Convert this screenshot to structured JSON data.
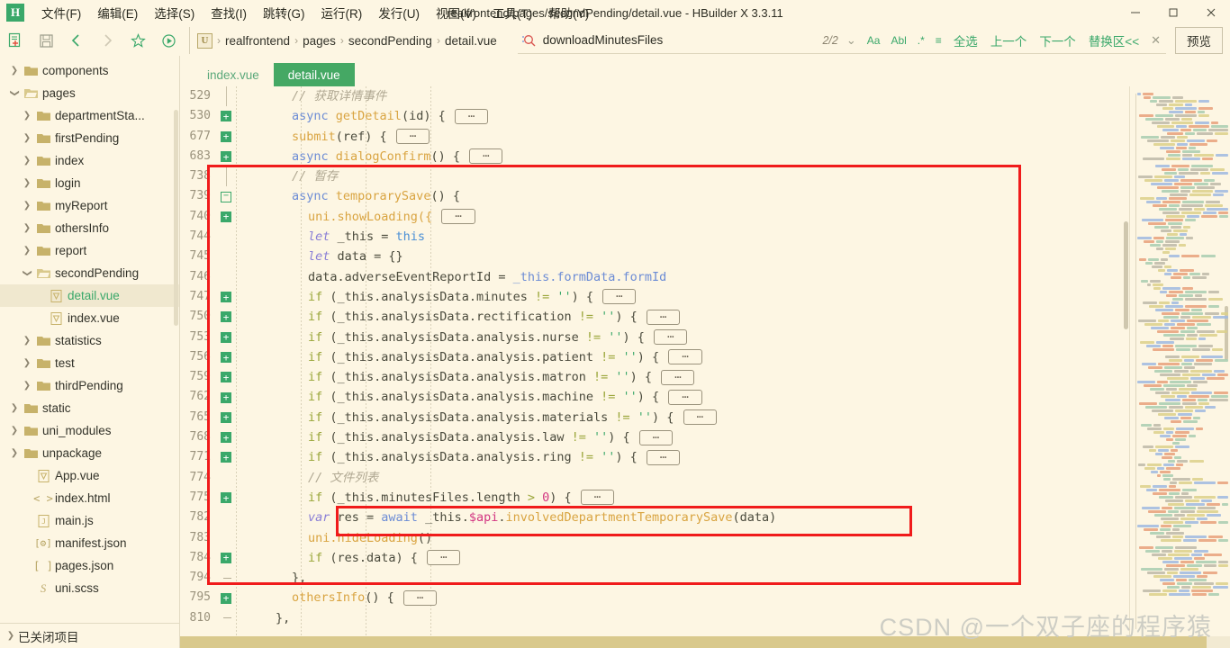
{
  "window": {
    "title": "realfrontend/pages/secondPending/detail.vue - HBuilder X 3.3.11",
    "minimize_label": "—",
    "maximize_label": "❐",
    "close_label": "✕"
  },
  "menubar": {
    "logo": "H",
    "items": [
      {
        "label": "文件(F)",
        "name": "menu-file"
      },
      {
        "label": "编辑(E)",
        "name": "menu-edit"
      },
      {
        "label": "选择(S)",
        "name": "menu-select"
      },
      {
        "label": "查找(I)",
        "name": "menu-find"
      },
      {
        "label": "跳转(G)",
        "name": "menu-goto"
      },
      {
        "label": "运行(R)",
        "name": "menu-run"
      },
      {
        "label": "发行(U)",
        "name": "menu-publish"
      },
      {
        "label": "视图(V)",
        "name": "menu-view"
      },
      {
        "label": "工具(T)",
        "name": "menu-tools"
      },
      {
        "label": "帮助(Y)",
        "name": "menu-help"
      }
    ]
  },
  "toolbar": {
    "icons": [
      {
        "name": "new-file-icon",
        "glyph": "new"
      },
      {
        "name": "save-icon",
        "glyph": "save"
      },
      {
        "name": "back-icon",
        "glyph": "back"
      },
      {
        "name": "forward-icon",
        "glyph": "forward"
      },
      {
        "name": "favorite-star-icon",
        "glyph": "star"
      },
      {
        "name": "run-icon",
        "glyph": "run"
      }
    ],
    "breadcrumb": {
      "project_badge": "U",
      "parts": [
        "realfrontend",
        "pages",
        "secondPending",
        "detail.vue"
      ],
      "separator": "›"
    },
    "preview_label": "预览"
  },
  "search": {
    "value": "downloadMinutesFiles",
    "placeholder": "查找",
    "match_count": "2/2",
    "dropdown_glyph": "⌄",
    "options": [
      {
        "name": "match-case-option",
        "label": "Aa"
      },
      {
        "name": "whole-word-option",
        "label": "Abl"
      },
      {
        "name": "regex-option",
        "label": ".*"
      },
      {
        "name": "in-selection-option",
        "label": "≡"
      }
    ],
    "links": [
      {
        "name": "select-all-link",
        "label": "全选"
      },
      {
        "name": "previous-match-link",
        "label": "上一个"
      },
      {
        "name": "next-match-link",
        "label": "下一个"
      },
      {
        "name": "replace-panel-link",
        "label": "替换区<<"
      }
    ],
    "close_label": "✕"
  },
  "sidebar": {
    "closed_projects_label": "已关闭项目",
    "tree": [
      {
        "label": "components",
        "type": "folder",
        "depth": 1,
        "expanded": false
      },
      {
        "label": "pages",
        "type": "folder",
        "depth": 1,
        "expanded": true
      },
      {
        "label": "departmentSta...",
        "type": "folder",
        "depth": 2,
        "expanded": false
      },
      {
        "label": "firstPending",
        "type": "folder",
        "depth": 2,
        "expanded": false
      },
      {
        "label": "index",
        "type": "folder",
        "depth": 2,
        "expanded": false
      },
      {
        "label": "login",
        "type": "folder",
        "depth": 2,
        "expanded": false
      },
      {
        "label": "myReport",
        "type": "folder",
        "depth": 2,
        "expanded": false
      },
      {
        "label": "othersInfo",
        "type": "folder",
        "depth": 2,
        "expanded": false
      },
      {
        "label": "report",
        "type": "folder",
        "depth": 2,
        "expanded": false
      },
      {
        "label": "secondPending",
        "type": "folder",
        "depth": 2,
        "expanded": true
      },
      {
        "label": "detail.vue",
        "type": "vue",
        "depth": 3,
        "selected": true
      },
      {
        "label": "index.vue",
        "type": "vue",
        "depth": 3
      },
      {
        "label": "statistics",
        "type": "folder",
        "depth": 2,
        "expanded": false
      },
      {
        "label": "test",
        "type": "folder",
        "depth": 2,
        "expanded": false
      },
      {
        "label": "thirdPending",
        "type": "folder",
        "depth": 2,
        "expanded": false
      },
      {
        "label": "static",
        "type": "folder",
        "depth": 1,
        "expanded": false
      },
      {
        "label": "uni_modules",
        "type": "folder",
        "depth": 1,
        "expanded": false
      },
      {
        "label": "unpackage",
        "type": "folder",
        "depth": 1,
        "expanded": false
      },
      {
        "label": "App.vue",
        "type": "vue",
        "depth": 2
      },
      {
        "label": "index.html",
        "type": "html",
        "depth": 2
      },
      {
        "label": "main.js",
        "type": "js",
        "depth": 2
      },
      {
        "label": "manifest.json",
        "type": "manifest",
        "depth": 2
      },
      {
        "label": "pages.json",
        "type": "json",
        "depth": 2
      },
      {
        "label": "uni.scss",
        "type": "scss",
        "depth": 2
      }
    ]
  },
  "tabs": [
    {
      "label": "index.vue",
      "active": false,
      "name": "tab-index-vue"
    },
    {
      "label": "detail.vue",
      "active": true,
      "name": "tab-detail-vue"
    }
  ],
  "editor": {
    "ellipsis": "⋯",
    "lines": [
      {
        "num": "529",
        "fold": "bar",
        "indent": 3,
        "tokens": [
          {
            "t": "// 获取详情事件",
            "c": "k-cmt"
          }
        ]
      },
      {
        "num": "530",
        "fold": "plus",
        "indent": 3,
        "tokens": [
          {
            "t": "async ",
            "c": "k-blue"
          },
          {
            "t": "getDetail",
            "c": "k-fn"
          },
          {
            "t": "(id) { ",
            "c": "k-pl"
          },
          {
            "t": "BOX",
            "c": "box"
          }
        ]
      },
      {
        "num": "677",
        "fold": "plus",
        "indent": 3,
        "tokens": [
          {
            "t": "submit",
            "c": "k-fn"
          },
          {
            "t": "(ref) { ",
            "c": "k-pl"
          },
          {
            "t": "BOX",
            "c": "box"
          }
        ]
      },
      {
        "num": "683",
        "fold": "plus",
        "indent": 3,
        "tokens": [
          {
            "t": "async ",
            "c": "k-blue"
          },
          {
            "t": "dialogConfirm",
            "c": "k-fn"
          },
          {
            "t": "() { ",
            "c": "k-pl"
          },
          {
            "t": "BOX",
            "c": "box"
          }
        ]
      },
      {
        "num": "738",
        "fold": "bar",
        "indent": 3,
        "tokens": [
          {
            "t": "// 暂存",
            "c": "k-cmt"
          }
        ]
      },
      {
        "num": "739",
        "fold": "minus",
        "indent": 3,
        "tokens": [
          {
            "t": "async ",
            "c": "k-blue"
          },
          {
            "t": "temporarySave",
            "c": "k-fn"
          },
          {
            "t": "() {",
            "c": "k-pl"
          }
        ]
      },
      {
        "num": "740",
        "fold": "plus",
        "indent": 4,
        "tokens": [
          {
            "t": "uni.showLoading({ ",
            "c": "k-fn"
          },
          {
            "t": "BOX",
            "c": "box"
          }
        ]
      },
      {
        "num": "744",
        "fold": "",
        "indent": 4,
        "tokens": [
          {
            "t": "let ",
            "c": "k-kw"
          },
          {
            "t": "_this = ",
            "c": "k-pl"
          },
          {
            "t": "this",
            "c": "k-kw2"
          }
        ]
      },
      {
        "num": "745",
        "fold": "",
        "indent": 4,
        "tokens": [
          {
            "t": "let ",
            "c": "k-kw"
          },
          {
            "t": "data = {}",
            "c": "k-pl"
          }
        ]
      },
      {
        "num": "746",
        "fold": "",
        "indent": 4,
        "tokens": [
          {
            "t": "data.adverseEventReportId = ",
            "c": "k-pl"
          },
          {
            "t": "_this.formData.formId",
            "c": "k-blue"
          }
        ]
      },
      {
        "num": "747",
        "fold": "plus",
        "indent": 4,
        "tokens": [
          {
            "t": "if ",
            "c": "k-ctl"
          },
          {
            "t": "(_this.analysisData.minutes ",
            "c": "k-pl"
          },
          {
            "t": "!=",
            "c": "k-ctl"
          },
          {
            "t": " ",
            "c": "k-pl"
          },
          {
            "t": "''",
            "c": "k-str"
          },
          {
            "t": ") { ",
            "c": "k-pl"
          },
          {
            "t": "BOX",
            "c": "box"
          }
        ]
      },
      {
        "num": "750",
        "fold": "plus",
        "indent": 4,
        "tokens": [
          {
            "t": "if ",
            "c": "k-ctl"
          },
          {
            "t": "(_this.analysisData.rectification ",
            "c": "k-pl"
          },
          {
            "t": "!=",
            "c": "k-ctl"
          },
          {
            "t": " ",
            "c": "k-pl"
          },
          {
            "t": "''",
            "c": "k-str"
          },
          {
            "t": ") { ",
            "c": "k-pl"
          },
          {
            "t": "BOX",
            "c": "box"
          }
        ]
      },
      {
        "num": "753",
        "fold": "plus",
        "indent": 4,
        "tokens": [
          {
            "t": "if ",
            "c": "k-ctl"
          },
          {
            "t": "(_this.analysisData.analysis.nurse ",
            "c": "k-pl"
          },
          {
            "t": "!=",
            "c": "k-ctl"
          },
          {
            "t": " ",
            "c": "k-pl"
          },
          {
            "t": "''",
            "c": "k-str"
          },
          {
            "t": ") { ",
            "c": "k-pl"
          },
          {
            "t": "BOX",
            "c": "box"
          }
        ]
      },
      {
        "num": "756",
        "fold": "plus",
        "indent": 4,
        "tokens": [
          {
            "t": "if ",
            "c": "k-ctl"
          },
          {
            "t": "(_this.analysisData.analysis.patient ",
            "c": "k-pl"
          },
          {
            "t": "!=",
            "c": "k-ctl"
          },
          {
            "t": " ",
            "c": "k-pl"
          },
          {
            "t": "''",
            "c": "k-str"
          },
          {
            "t": ") { ",
            "c": "k-pl"
          },
          {
            "t": "BOX",
            "c": "box"
          }
        ]
      },
      {
        "num": "759",
        "fold": "plus",
        "indent": 4,
        "tokens": [
          {
            "t": "if ",
            "c": "k-ctl"
          },
          {
            "t": "(_this.analysisData.analysis.matron ",
            "c": "k-pl"
          },
          {
            "t": "!=",
            "c": "k-ctl"
          },
          {
            "t": " ",
            "c": "k-pl"
          },
          {
            "t": "''",
            "c": "k-str"
          },
          {
            "t": ") { ",
            "c": "k-pl"
          },
          {
            "t": "BOX",
            "c": "box"
          }
        ]
      },
      {
        "num": "762",
        "fold": "plus",
        "indent": 4,
        "tokens": [
          {
            "t": "if ",
            "c": "k-ctl"
          },
          {
            "t": "(_this.analysisData.analysis.machine ",
            "c": "k-pl"
          },
          {
            "t": "!=",
            "c": "k-ctl"
          },
          {
            "t": " ",
            "c": "k-pl"
          },
          {
            "t": "''",
            "c": "k-str"
          },
          {
            "t": ") { ",
            "c": "k-pl"
          },
          {
            "t": "BOX",
            "c": "box"
          }
        ]
      },
      {
        "num": "765",
        "fold": "plus",
        "indent": 4,
        "tokens": [
          {
            "t": "if ",
            "c": "k-ctl"
          },
          {
            "t": "(_this.analysisData.analysis.materials ",
            "c": "k-pl"
          },
          {
            "t": "!=",
            "c": "k-ctl"
          },
          {
            "t": " ",
            "c": "k-pl"
          },
          {
            "t": "''",
            "c": "k-str"
          },
          {
            "t": ") { ",
            "c": "k-pl"
          },
          {
            "t": "BOX",
            "c": "box"
          }
        ]
      },
      {
        "num": "768",
        "fold": "plus",
        "indent": 4,
        "tokens": [
          {
            "t": "if ",
            "c": "k-ctl"
          },
          {
            "t": "(_this.analysisData.analysis.law ",
            "c": "k-pl"
          },
          {
            "t": "!=",
            "c": "k-ctl"
          },
          {
            "t": " ",
            "c": "k-pl"
          },
          {
            "t": "''",
            "c": "k-str"
          },
          {
            "t": ") { ",
            "c": "k-pl"
          },
          {
            "t": "BOX",
            "c": "box"
          }
        ]
      },
      {
        "num": "771",
        "fold": "plus",
        "indent": 4,
        "tokens": [
          {
            "t": "if ",
            "c": "k-ctl"
          },
          {
            "t": "(_this.analysisData.analysis.ring ",
            "c": "k-pl"
          },
          {
            "t": "!=",
            "c": "k-ctl"
          },
          {
            "t": " ",
            "c": "k-pl"
          },
          {
            "t": "''",
            "c": "k-str"
          },
          {
            "t": ") { ",
            "c": "k-pl"
          },
          {
            "t": "BOX",
            "c": "box"
          }
        ]
      },
      {
        "num": "774",
        "fold": "",
        "indent": 4,
        "tokens": [
          {
            "t": "// 文件列表",
            "c": "k-cmt"
          }
        ]
      },
      {
        "num": "775",
        "fold": "plus",
        "indent": 4,
        "tokens": [
          {
            "t": "if ",
            "c": "k-ctl"
          },
          {
            "t": "(_this.minutesFiles.length ",
            "c": "k-pl"
          },
          {
            "t": ">",
            "c": "k-ctl"
          },
          {
            "t": " ",
            "c": "k-pl"
          },
          {
            "t": "0",
            "c": "k-num"
          },
          {
            "t": ") { ",
            "c": "k-pl"
          },
          {
            "t": "BOX",
            "c": "box"
          }
        ]
      },
      {
        "num": "782",
        "fold": "",
        "indent": 4,
        "highlight": true,
        "tokens": [
          {
            "t": "var ",
            "c": "k-kw"
          },
          {
            "t": "res = ",
            "c": "k-pl"
          },
          {
            "t": "await",
            "c": "k-blue"
          },
          {
            "t": " _this.",
            "c": "k-pl"
          },
          {
            "t": "$api",
            "c": "k-num"
          },
          {
            "t": ".",
            "c": "k-pl"
          },
          {
            "t": "involvedDepartmentTemporarySave",
            "c": "k-fn"
          },
          {
            "t": "(data)",
            "c": "k-pl"
          }
        ]
      },
      {
        "num": "783",
        "fold": "",
        "indent": 4,
        "tokens": [
          {
            "t": "uni.hideLoading",
            "c": "k-fn"
          },
          {
            "t": "()",
            "c": "k-pl"
          }
        ]
      },
      {
        "num": "784",
        "fold": "plus",
        "indent": 4,
        "tokens": [
          {
            "t": "if ",
            "c": "k-ctl"
          },
          {
            "t": "(res.data) { ",
            "c": "k-pl"
          },
          {
            "t": "BOX",
            "c": "box"
          }
        ]
      },
      {
        "num": "794",
        "fold": "end",
        "indent": 3,
        "tokens": [
          {
            "t": "},",
            "c": "k-pl"
          }
        ]
      },
      {
        "num": "795",
        "fold": "plus",
        "indent": 3,
        "tokens": [
          {
            "t": "othersInfo",
            "c": "k-fn"
          },
          {
            "t": "() { ",
            "c": "k-pl"
          },
          {
            "t": "BOX",
            "c": "box"
          }
        ]
      },
      {
        "num": "810",
        "fold": "end",
        "indent": 2,
        "tokens": [
          {
            "t": "},",
            "c": "k-pl"
          }
        ]
      }
    ]
  },
  "annotations": {
    "region_box_label": "red-region-highlight",
    "line_box_label": "red-line-highlight"
  },
  "watermark": {
    "text": "CSDN @一个双子座的程序猿"
  },
  "colors": {
    "accent_green": "#3aa86a",
    "tab_active": "#45a864",
    "editor_bg": "#fdf6e3",
    "annotation_red": "#f01b1b",
    "scrollbar": "#d9c98c"
  },
  "minimap": {
    "name": "code-minimap",
    "palette": [
      "#9fb8e0",
      "#e8a07a",
      "#a8cdb0",
      "#bdb9a8",
      "#dcd08a"
    ]
  }
}
